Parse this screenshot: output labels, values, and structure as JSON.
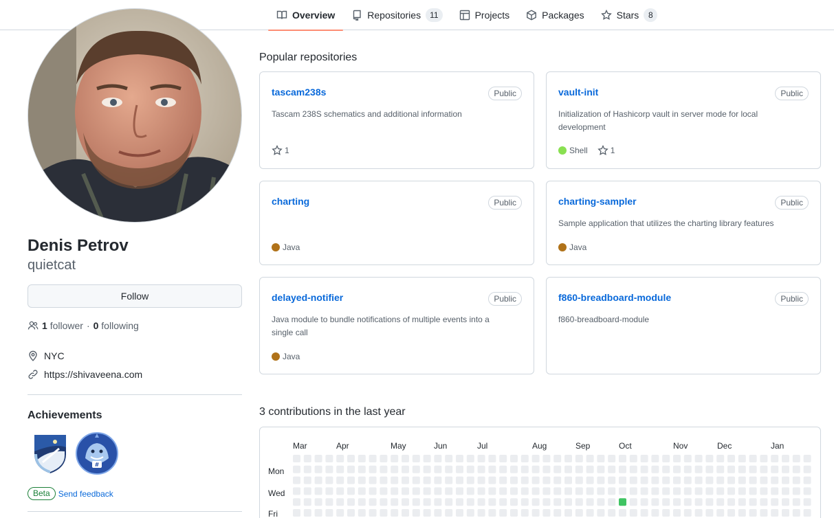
{
  "nav": {
    "tabs": [
      {
        "label": "Overview",
        "icon": "book-icon",
        "count": null
      },
      {
        "label": "Repositories",
        "icon": "repo-icon",
        "count": "11"
      },
      {
        "label": "Projects",
        "icon": "table-icon",
        "count": null
      },
      {
        "label": "Packages",
        "icon": "package-icon",
        "count": null
      },
      {
        "label": "Stars",
        "icon": "star-icon",
        "count": "8"
      }
    ],
    "selected": "Overview",
    "accent_color": "#fd8c73"
  },
  "profile": {
    "name": "Denis Petrov",
    "login": "quietcat",
    "follow_label": "Follow",
    "followers_count": "1",
    "followers_label": "follower",
    "separator": "·",
    "following_count": "0",
    "following_label": "following",
    "location": "NYC",
    "website": "https://shivaveena.com"
  },
  "achievements": {
    "title": "Achievements",
    "badges": [
      "arctic-code-vault-badge-icon",
      "shark-badge-icon"
    ],
    "beta_label": "Beta",
    "feedback_label": "Send feedback"
  },
  "popular": {
    "title": "Popular repositories",
    "repos": [
      {
        "name": "tascam238s",
        "visibility": "Public",
        "description": "Tascam 238S schematics and additional information",
        "language": null,
        "lang_color": null,
        "stars": "1"
      },
      {
        "name": "vault-init",
        "visibility": "Public",
        "description": "Initialization of Hashicorp vault in server mode for local development",
        "language": "Shell",
        "lang_color": "#89e051",
        "stars": "1"
      },
      {
        "name": "charting",
        "visibility": "Public",
        "description": "",
        "language": "Java",
        "lang_color": "#b07219",
        "stars": null
      },
      {
        "name": "charting-sampler",
        "visibility": "Public",
        "description": "Sample application that utilizes the charting library features",
        "language": "Java",
        "lang_color": "#b07219",
        "stars": null
      },
      {
        "name": "delayed-notifier",
        "visibility": "Public",
        "description": "Java module to bundle notifications of multiple events into a single call",
        "language": "Java",
        "lang_color": "#b07219",
        "stars": null
      },
      {
        "name": "f860-breadboard-module",
        "visibility": "Public",
        "description": "f860-breadboard-module",
        "language": null,
        "lang_color": null,
        "stars": null
      }
    ]
  },
  "contributions": {
    "title": "3 contributions in the last year",
    "months": [
      "Mar",
      "Apr",
      "May",
      "Jun",
      "Jul",
      "Aug",
      "Sep",
      "Oct",
      "Nov",
      "Dec",
      "Jan"
    ],
    "days": [
      "Mon",
      "Wed",
      "Fri"
    ],
    "empty_color": "#ebedf0",
    "active_color": "#40c463"
  }
}
